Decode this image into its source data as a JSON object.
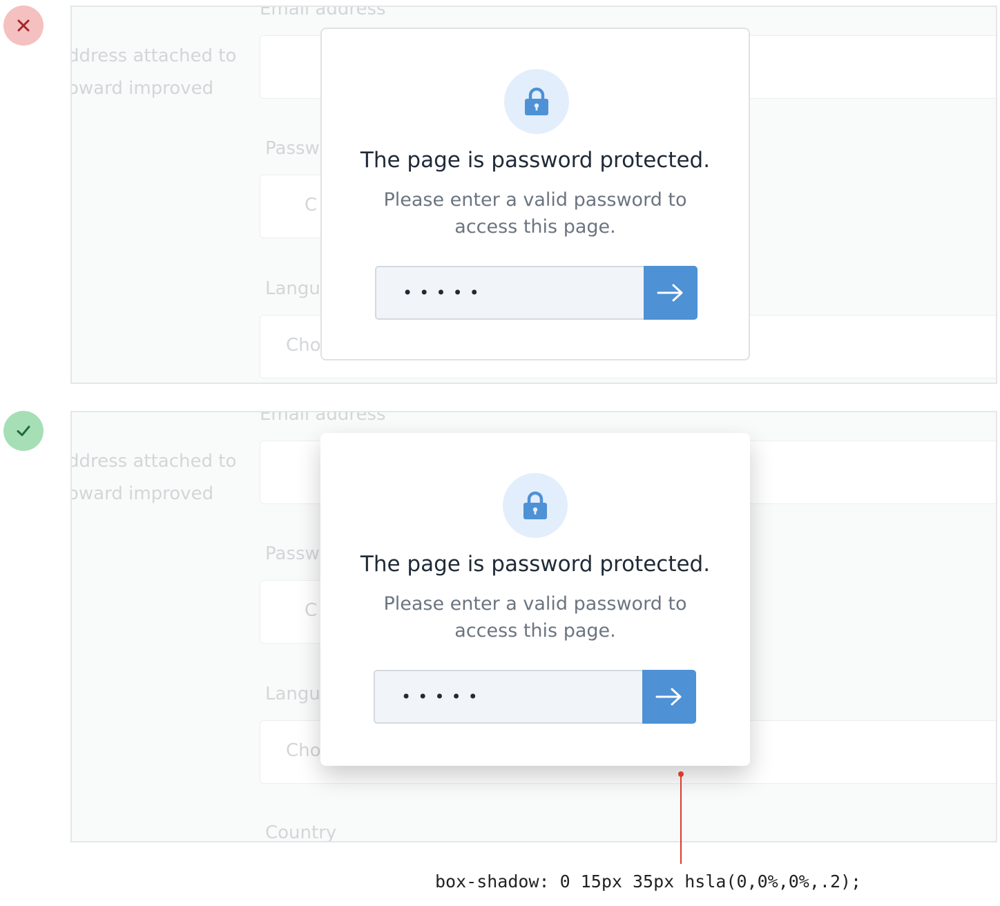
{
  "background_form": {
    "email_label": "Email address",
    "helper_line1": "ddress attached to",
    "helper_line2": "oward improved",
    "password_label": "Passw",
    "password_placeholder": "C",
    "language_label": "Langu",
    "language_placeholder": "Cho",
    "country_label": "Country"
  },
  "modal": {
    "icon": "lock-icon",
    "title": "The page is password protected.",
    "subtitle": "Please enter a valid password to access this page.",
    "password_value": "•••••",
    "submit_icon": "arrow-right-icon"
  },
  "examples": {
    "bad_icon": "x-icon",
    "good_icon": "check-icon"
  },
  "annotation": {
    "code": "box-shadow: 0 15px 35px hsla(0,0%,0%,.2);"
  },
  "colors": {
    "accent": "#4e91d5",
    "bad": "#f4c0c0",
    "good": "#a6dfb6",
    "annotation": "#d93a2b"
  }
}
